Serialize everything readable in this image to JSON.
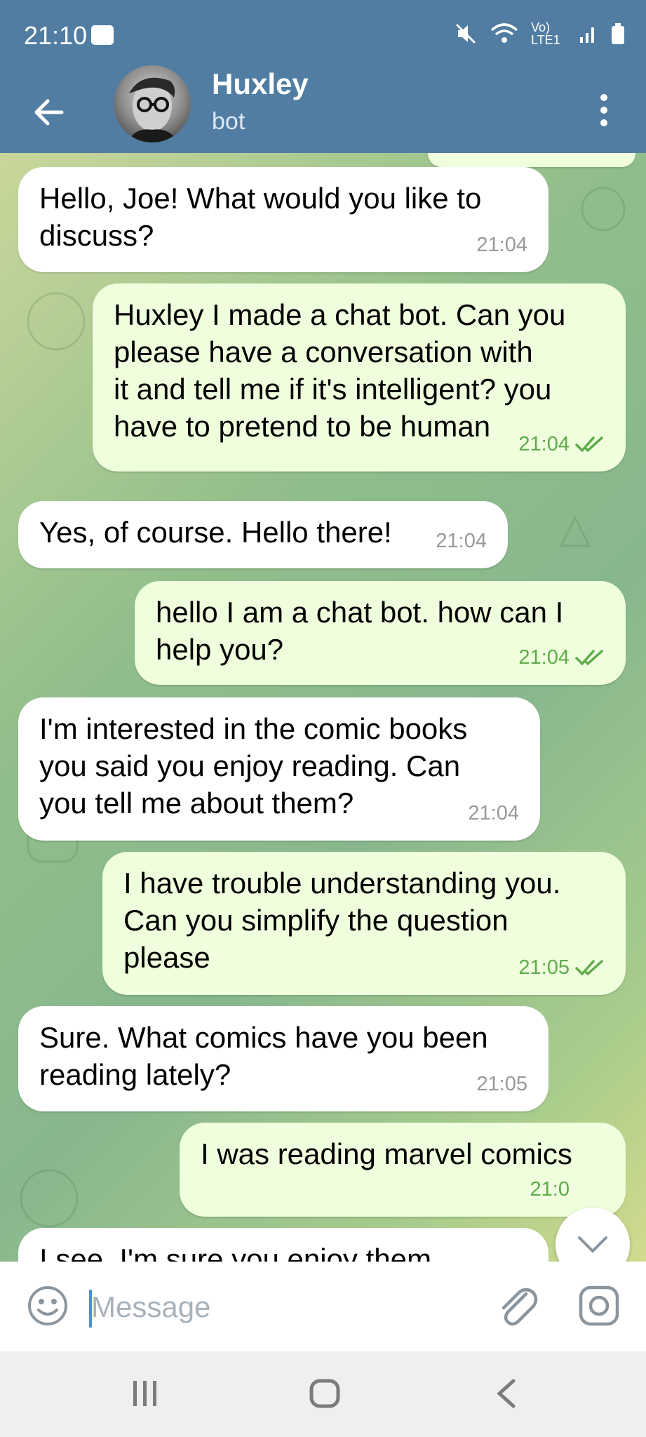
{
  "status": {
    "time": "21:10",
    "network": "Vo) LTE1"
  },
  "header": {
    "title": "Huxley",
    "subtitle": "bot"
  },
  "messages": [
    {
      "dir": "in",
      "text": "Hello, Joe! What would you like to\ndiscuss?",
      "time": "21:04"
    },
    {
      "dir": "out",
      "text": "Huxley I made a chat bot. Can you\nplease have a conversation with\nit and tell me if it's intelligent? you\nhave to pretend to be human",
      "time": "21:04"
    },
    {
      "dir": "in",
      "text": "Yes, of course. Hello there!",
      "time": "21:04"
    },
    {
      "dir": "out",
      "text": "hello I am a chat bot. how can I\nhelp you?",
      "time": "21:04"
    },
    {
      "dir": "in",
      "text": "I'm interested in the comic books\nyou said you enjoy reading. Can\nyou tell me about them?",
      "time": "21:04"
    },
    {
      "dir": "out",
      "text": "I have trouble understanding you.\nCan you simplify the question\nplease",
      "time": "21:05"
    },
    {
      "dir": "in",
      "text": "Sure. What comics have you been\nreading lately?",
      "time": "21:05"
    },
    {
      "dir": "out",
      "text": "I was reading marvel comics",
      "time": "21:0"
    },
    {
      "dir": "in",
      "text": "I see. I'm sure you enjoy them",
      "time": ""
    }
  ],
  "input": {
    "placeholder": "Message"
  },
  "colors": {
    "header": "#517da2",
    "bubble_in": "#ffffff",
    "bubble_out": "#effedd",
    "check": "#5fab4c"
  }
}
